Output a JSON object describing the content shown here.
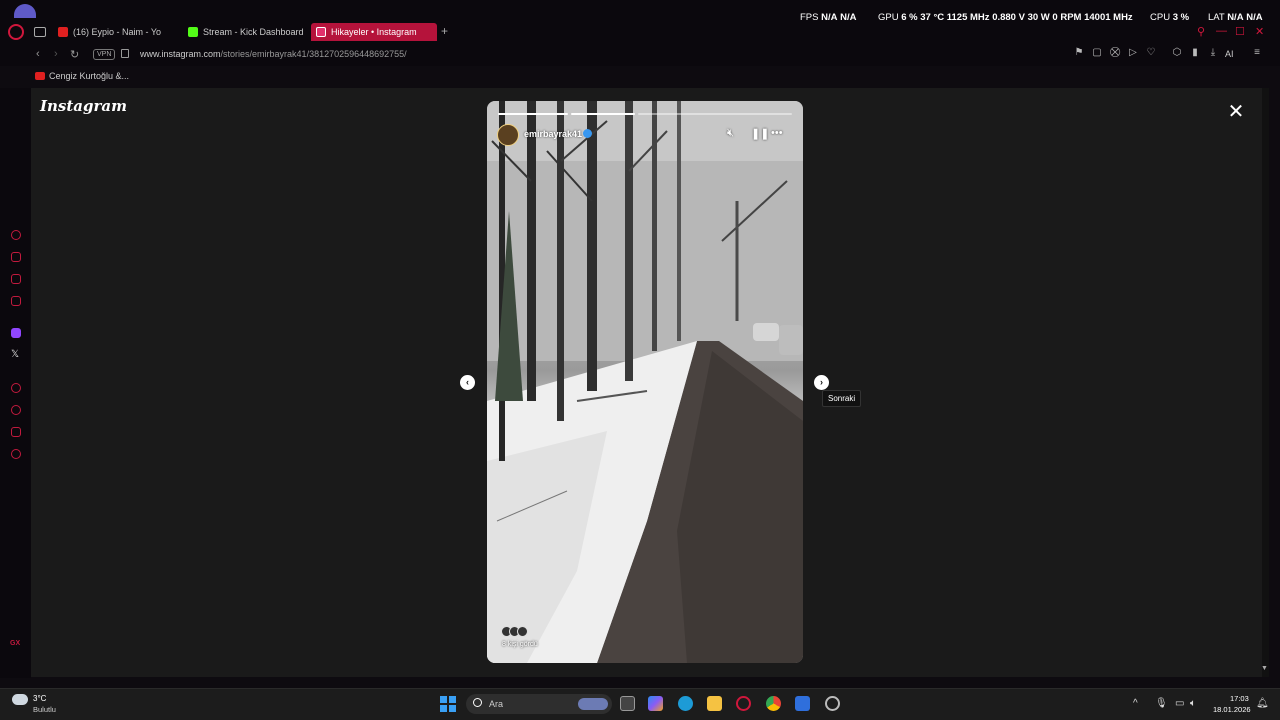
{
  "browser": {
    "tabs": [
      {
        "label": "(16) Eypio - Naim - Yo",
        "color": "#e02020"
      },
      {
        "label": "Stream - Kick Dashboard",
        "color": "#53fc18"
      },
      {
        "label": "Hikayeler • Instagram",
        "color": "#e1306c"
      }
    ],
    "new_tab": "+",
    "vpn_label": "VPN",
    "url_host": "www.instagram.com",
    "url_path": "/stories/emirbayrak41/3812702596448692755/",
    "ai_label": "AI",
    "bookmark_label": "Cengiz Kurtoğlu &...",
    "window_controls": [
      "⚲",
      "—",
      "☐",
      "✕"
    ]
  },
  "osd": {
    "fps_label": "FPS",
    "fps_value": "N/A",
    "fps_value2": "N/A",
    "gpu_label": "GPU",
    "gpu_load": "6 %",
    "gpu_temp": "37 °C",
    "gpu_clock": "1125 MHz",
    "gpu_volt": "0.880 V",
    "gpu_power": "30 W",
    "gpu_fan": "0 RPM",
    "gpu_mem": "14001 MHz",
    "cpu_label": "CPU",
    "cpu_load": "3 %",
    "lat_label": "LAT",
    "lat_value": "N/A",
    "lat_value2": "N/A"
  },
  "instagram": {
    "logo": "Instagram",
    "close": "✕",
    "story": {
      "username": "emirbayrak41",
      "viewers_text": "8 kişi gördü",
      "progress_segments": [
        {
          "state": "done"
        },
        {
          "state": "done"
        },
        {
          "state": "active"
        }
      ]
    },
    "prev": "‹",
    "next": "›",
    "next_tooltip": "Sonraki"
  },
  "taskbar": {
    "weather_temp": "3°C",
    "weather_desc": "Bulutlu",
    "search_placeholder": "Ara",
    "clock_time": "17:03",
    "clock_date": "18.01.2026"
  },
  "colors": {
    "opera_accent": "#c21a3e",
    "active_tab": "#b5133b",
    "viewer_bg": "#1a1a1a"
  }
}
